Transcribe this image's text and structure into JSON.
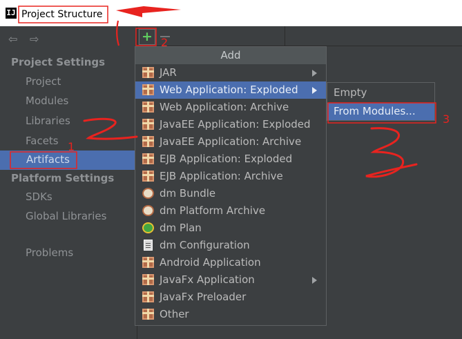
{
  "window": {
    "title": "Project Structure",
    "app_icon": "IJ"
  },
  "toolbar": {
    "add_icon": "+"
  },
  "sidebar": {
    "nav_back": "⇦",
    "nav_forward": "⇨",
    "project_settings_header": "Project Settings",
    "project_items": [
      {
        "label": "Project"
      },
      {
        "label": "Modules"
      },
      {
        "label": "Libraries"
      },
      {
        "label": "Facets"
      },
      {
        "label": "Artifacts",
        "selected": true
      }
    ],
    "platform_settings_header": "Platform Settings",
    "platform_items": [
      {
        "label": "SDKs"
      },
      {
        "label": "Global Libraries"
      }
    ],
    "problems": "Problems"
  },
  "add_menu": {
    "header": "Add",
    "items": [
      {
        "label": "JAR",
        "icon": "gift-icon",
        "submenu": true
      },
      {
        "label": "Web Application: Exploded",
        "icon": "gift-icon",
        "submenu": true,
        "highlighted": true
      },
      {
        "label": "Web Application: Archive",
        "icon": "gift-icon"
      },
      {
        "label": "JavaEE Application: Exploded",
        "icon": "gift-icon"
      },
      {
        "label": "JavaEE Application: Archive",
        "icon": "gift-icon"
      },
      {
        "label": "EJB Application: Exploded",
        "icon": "gift-icon"
      },
      {
        "label": "EJB Application: Archive",
        "icon": "gift-icon"
      },
      {
        "label": "dm Bundle",
        "icon": "bundle-icon"
      },
      {
        "label": "dm Platform Archive",
        "icon": "bundle-icon"
      },
      {
        "label": "dm Plan",
        "icon": "plan-icon"
      },
      {
        "label": "dm Configuration",
        "icon": "document-icon"
      },
      {
        "label": "Android Application",
        "icon": "gift-icon"
      },
      {
        "label": "JavaFx Application",
        "icon": "gift-icon",
        "submenu": true
      },
      {
        "label": "JavaFx Preloader",
        "icon": "gift-icon"
      },
      {
        "label": "Other",
        "icon": "gift-icon"
      }
    ]
  },
  "submenu": {
    "items": [
      {
        "label": "Empty"
      },
      {
        "label": "From Modules...",
        "highlighted": true
      }
    ]
  },
  "annotations": {
    "numbers": [
      "1",
      "2",
      "3"
    ],
    "color": "#e8231f"
  },
  "colors": {
    "panel_bg": "#3c3f41",
    "selection": "#4b6eaf",
    "menu_header": "#515658",
    "text": "#bbbbbb",
    "add_green": "#5fcc5f"
  }
}
